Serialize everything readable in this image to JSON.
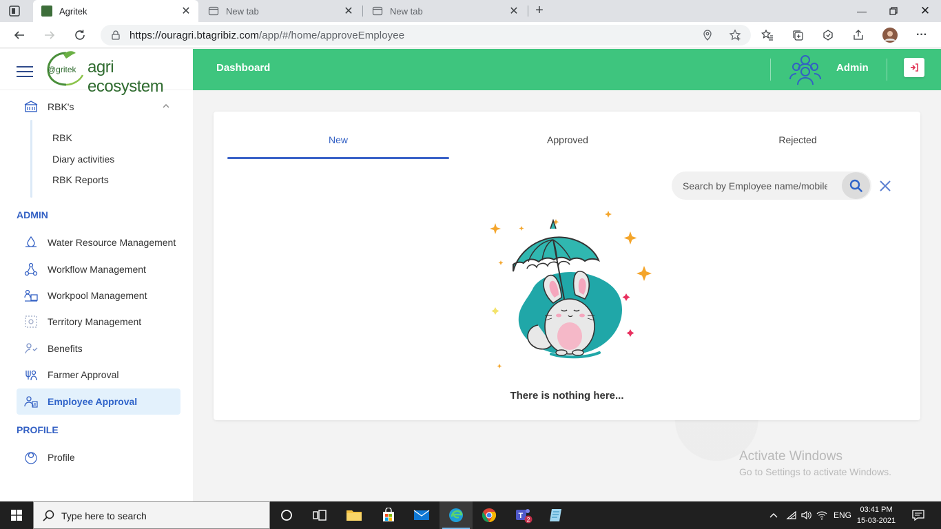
{
  "browser": {
    "tabs": [
      {
        "title": "Agritek",
        "active": true
      },
      {
        "title": "New tab",
        "active": false
      },
      {
        "title": "New tab",
        "active": false
      }
    ],
    "url_host": "https://ouragri.btagribiz.com",
    "url_path": "/app/#/home/approveEmployee"
  },
  "app": {
    "brand_prefix": "@gritek",
    "brand_name": "agri ecosystem",
    "topbar_title": "Dashboard",
    "user_name": "Admin",
    "accent_green": "#3ec57e",
    "accent_blue": "#3360c4"
  },
  "sidebar": {
    "rbk_group": {
      "label": "RBK's",
      "children": [
        "RBK",
        "Diary activities",
        "RBK Reports"
      ]
    },
    "admin_section": "ADMIN",
    "admin_items": [
      {
        "label": "Water Resource Management",
        "icon": "water-resource-icon"
      },
      {
        "label": "Workflow Management",
        "icon": "workflow-icon"
      },
      {
        "label": "Workpool Management",
        "icon": "workpool-icon"
      },
      {
        "label": "Territory Management",
        "icon": "territory-icon"
      },
      {
        "label": "Benefits",
        "icon": "benefits-icon"
      },
      {
        "label": "Farmer Approval",
        "icon": "farmer-approval-icon"
      },
      {
        "label": "Employee Approval",
        "icon": "employee-approval-icon",
        "active": true
      }
    ],
    "profile_section": "PROFILE",
    "profile_items": [
      {
        "label": "Profile",
        "icon": "profile-icon"
      }
    ]
  },
  "main": {
    "tabs": [
      {
        "label": "New",
        "active": true
      },
      {
        "label": "Approved",
        "active": false
      },
      {
        "label": "Rejected",
        "active": false
      }
    ],
    "search_placeholder": "Search by Employee name/mobile",
    "empty_message": "There is nothing here..."
  },
  "os": {
    "watermark_title": "Activate Windows",
    "watermark_sub": "Go to Settings to activate Windows.",
    "taskbar_search": "Type here to search",
    "lang": "ENG",
    "time": "03:41 PM",
    "date": "15-03-2021",
    "teams_badge": "2"
  }
}
